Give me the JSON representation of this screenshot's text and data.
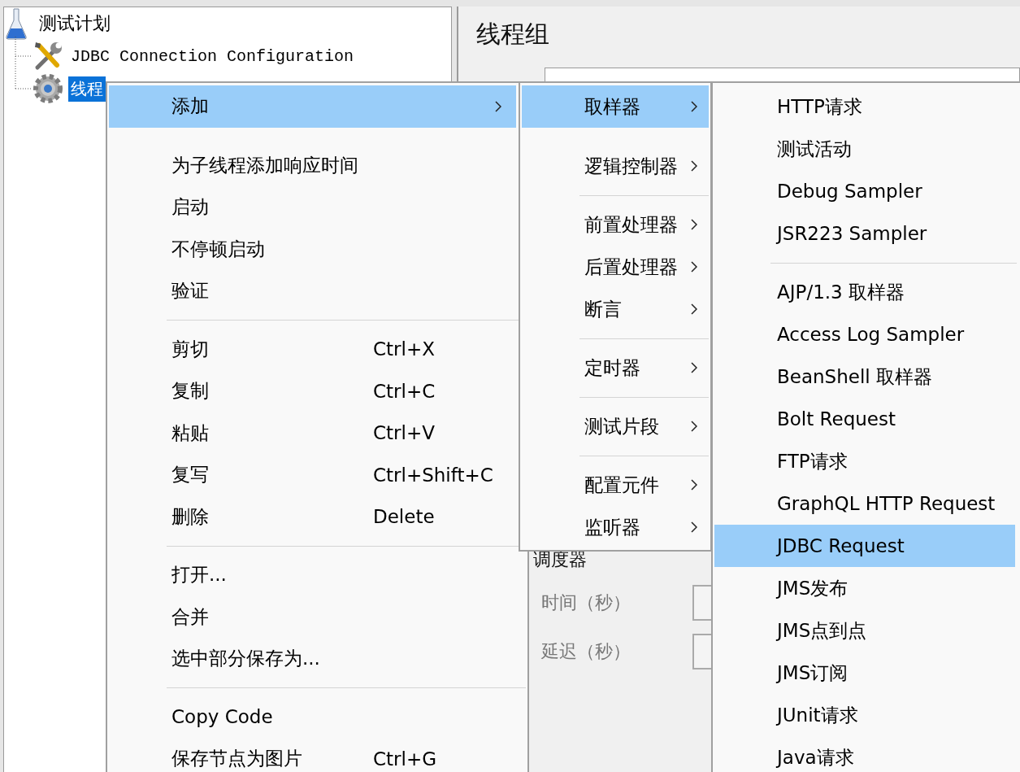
{
  "tree": [
    {
      "label": "测试计划",
      "selected": false,
      "children": [
        {
          "label": "JDBC Connection Configuration",
          "selected": false
        },
        {
          "label": "线程",
          "selected": true
        }
      ]
    }
  ],
  "panel": {
    "title": "线程组",
    "scheduler_label": "调度器",
    "fields": [
      {
        "label": "时间（秒）"
      },
      {
        "label": "延迟（秒）"
      }
    ]
  },
  "context_menu": [
    {
      "kind": "item",
      "label": "添加",
      "submenu": true,
      "selected": true
    },
    {
      "kind": "spacer"
    },
    {
      "kind": "item",
      "label": "为子线程添加响应时间",
      "submenu": false,
      "selected": false
    },
    {
      "kind": "item",
      "label": "启动",
      "submenu": false,
      "selected": false
    },
    {
      "kind": "item",
      "label": "不停顿启动",
      "submenu": false,
      "selected": false
    },
    {
      "kind": "item",
      "label": "验证",
      "submenu": false,
      "selected": false
    },
    {
      "kind": "separator"
    },
    {
      "kind": "item",
      "label": "剪切",
      "shortcut": "Ctrl+X",
      "submenu": false,
      "selected": false
    },
    {
      "kind": "item",
      "label": "复制",
      "shortcut": "Ctrl+C",
      "submenu": false,
      "selected": false
    },
    {
      "kind": "item",
      "label": "粘贴",
      "shortcut": "Ctrl+V",
      "submenu": false,
      "selected": false
    },
    {
      "kind": "item",
      "label": "复写",
      "shortcut": "Ctrl+Shift+C",
      "submenu": false,
      "selected": false
    },
    {
      "kind": "item",
      "label": "删除",
      "shortcut": "Delete",
      "submenu": false,
      "selected": false
    },
    {
      "kind": "separator"
    },
    {
      "kind": "item",
      "label": "打开...",
      "submenu": false,
      "selected": false
    },
    {
      "kind": "item",
      "label": "合并",
      "submenu": false,
      "selected": false
    },
    {
      "kind": "item",
      "label": "选中部分保存为...",
      "submenu": false,
      "selected": false
    },
    {
      "kind": "separator"
    },
    {
      "kind": "item",
      "label": "Copy Code",
      "submenu": false,
      "selected": false
    },
    {
      "kind": "item",
      "label": "保存节点为图片",
      "shortcut": "Ctrl+G",
      "submenu": false,
      "selected": false
    }
  ],
  "add_submenu": [
    {
      "kind": "item",
      "label": "取样器",
      "submenu": true,
      "selected": true
    },
    {
      "kind": "spacer"
    },
    {
      "kind": "item",
      "label": "逻辑控制器",
      "submenu": true,
      "selected": false
    },
    {
      "kind": "separator"
    },
    {
      "kind": "item",
      "label": "前置处理器",
      "submenu": true,
      "selected": false
    },
    {
      "kind": "item",
      "label": "后置处理器",
      "submenu": true,
      "selected": false
    },
    {
      "kind": "item",
      "label": "断言",
      "submenu": true,
      "selected": false
    },
    {
      "kind": "separator"
    },
    {
      "kind": "item",
      "label": "定时器",
      "submenu": true,
      "selected": false
    },
    {
      "kind": "separator"
    },
    {
      "kind": "item",
      "label": "测试片段",
      "submenu": true,
      "selected": false
    },
    {
      "kind": "separator"
    },
    {
      "kind": "item",
      "label": "配置元件",
      "submenu": true,
      "selected": false
    },
    {
      "kind": "item",
      "label": "监听器",
      "submenu": true,
      "selected": false
    }
  ],
  "sampler_submenu": [
    {
      "kind": "item",
      "label": "HTTP请求",
      "submenu": false,
      "selected": false
    },
    {
      "kind": "item",
      "label": "测试活动",
      "submenu": false,
      "selected": false
    },
    {
      "kind": "item",
      "label": "Debug Sampler",
      "submenu": false,
      "selected": false
    },
    {
      "kind": "item",
      "label": "JSR223 Sampler",
      "submenu": false,
      "selected": false
    },
    {
      "kind": "separator"
    },
    {
      "kind": "item",
      "label": "AJP/1.3 取样器",
      "submenu": false,
      "selected": false
    },
    {
      "kind": "item",
      "label": "Access Log Sampler",
      "submenu": false,
      "selected": false
    },
    {
      "kind": "item",
      "label": "BeanShell 取样器",
      "submenu": false,
      "selected": false
    },
    {
      "kind": "item",
      "label": "Bolt Request",
      "submenu": false,
      "selected": false
    },
    {
      "kind": "item",
      "label": "FTP请求",
      "submenu": false,
      "selected": false
    },
    {
      "kind": "item",
      "label": "GraphQL HTTP Request",
      "submenu": false,
      "selected": false
    },
    {
      "kind": "item",
      "label": "JDBC Request",
      "submenu": false,
      "selected": true
    },
    {
      "kind": "item",
      "label": "JMS发布",
      "submenu": false,
      "selected": false
    },
    {
      "kind": "item",
      "label": "JMS点到点",
      "submenu": false,
      "selected": false
    },
    {
      "kind": "item",
      "label": "JMS订阅",
      "submenu": false,
      "selected": false
    },
    {
      "kind": "item",
      "label": "JUnit请求",
      "submenu": false,
      "selected": false
    },
    {
      "kind": "item",
      "label": "Java请求",
      "submenu": false,
      "selected": false
    }
  ]
}
